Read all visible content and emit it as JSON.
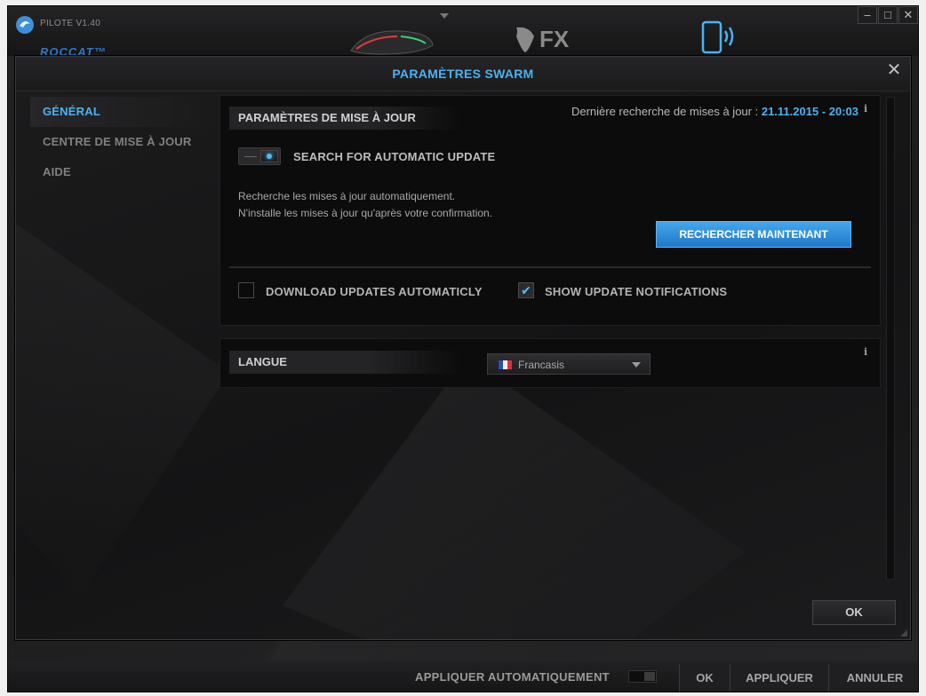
{
  "app": {
    "version": "PILOTE V1.40",
    "brand": "ROCCAT™",
    "nav": [
      "mouse-device-icon",
      "fx-icon",
      "mobile-swarm-icon"
    ],
    "window_buttons": {
      "minimize": "–",
      "maximize": "□",
      "close": "✕"
    },
    "bottom_bar": {
      "auto_apply_label": "APPLIQUER AUTOMATIQUEMENT",
      "auto_apply_on": false,
      "ok": "OK",
      "apply": "APPLIQUER",
      "cancel": "ANNULER"
    }
  },
  "modal": {
    "title": "PARAMÈTRES SWARM",
    "close_glyph": "✕",
    "sidebar": {
      "items": [
        {
          "label": "GÉNÉRAL",
          "active": true
        },
        {
          "label": "CENTRE DE MISE À JOUR",
          "active": false
        },
        {
          "label": "AIDE",
          "active": false
        }
      ]
    },
    "update_section": {
      "title": "PARAMÈTRES DE MISE À JOUR",
      "last_check_label": "Dernière recherche de mises à jour :",
      "last_check_date": "21.11.2015 - 20:03",
      "info_glyph": "i",
      "auto_update_toggle": {
        "label": "SEARCH FOR AUTOMATIC UPDATE",
        "on": true
      },
      "description": [
        "Recherche les mises à jour automatiquement.",
        "N'installe les mises à jour qu'après votre confirmation."
      ],
      "search_now_button": "RECHERCHER MAINTENANT",
      "check_glyph": "✔",
      "download_auto": {
        "label": "DOWNLOAD UPDATES AUTOMATICLY",
        "checked": false
      },
      "show_notifications": {
        "label": "SHOW UPDATE NOTIFICATIONS",
        "checked": true
      }
    },
    "language_section": {
      "title": "LANGUE",
      "info_glyph": "i",
      "selected": "Francasis",
      "flag": "flag-france-icon"
    },
    "ok_button": "OK"
  },
  "colors": {
    "accent": "#4bb2f2",
    "button_primary": "#2b8ad8",
    "background": "#151516",
    "panel": "#0c0c0d"
  }
}
